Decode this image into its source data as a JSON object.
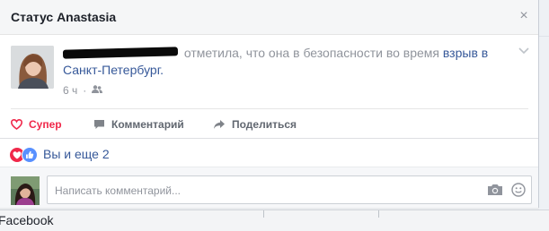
{
  "dialog": {
    "title": "Статус Anastasia",
    "close_glyph": "×"
  },
  "post": {
    "action_text": " отметила, что она в безопасности во время ",
    "link_text": "взрыв в Санкт-Петербург",
    "link_suffix": ".",
    "time": "6 ч",
    "separator": "·",
    "audience_icon": "friends-icon"
  },
  "actions": {
    "super_label": "Супер",
    "comment_label": "Комментарий",
    "share_label": "Поделиться"
  },
  "reactions": {
    "summary": "Вы и еще 2",
    "icons": [
      "love-icon",
      "like-icon"
    ]
  },
  "comment": {
    "placeholder": "Написать комментарий..."
  },
  "footer": {
    "text": "Facebook"
  },
  "colors": {
    "super": "#f0284a",
    "link": "#365899",
    "meta": "#90949c",
    "like": "#5890ff"
  }
}
